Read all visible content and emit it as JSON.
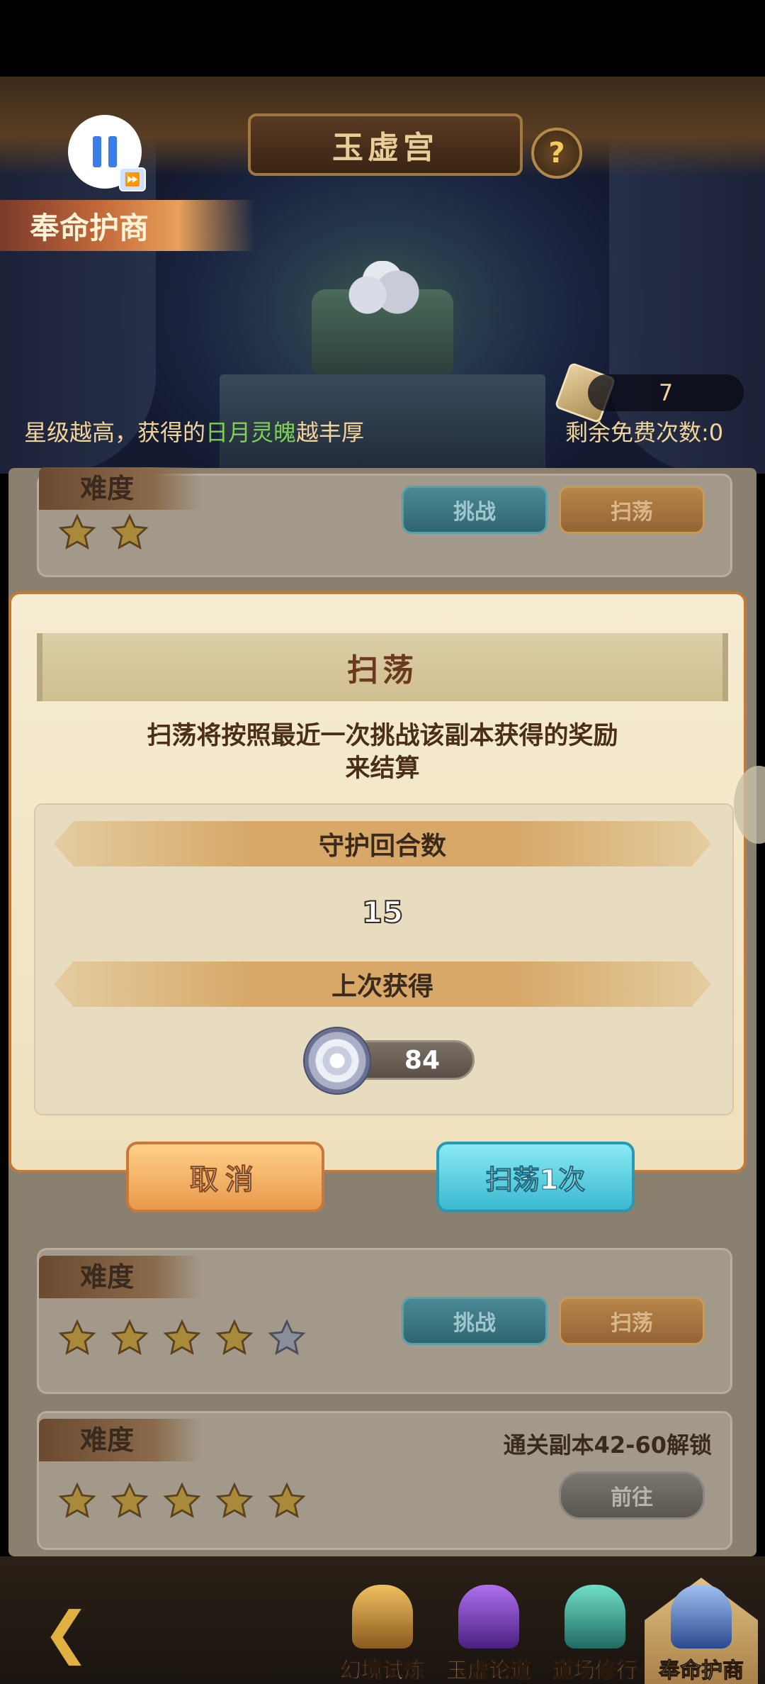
{
  "header": {
    "title": "玉虚宫",
    "help_label": "?",
    "banner": "奉命护商",
    "hint_prefix": "星级越高，获得的",
    "hint_highlight": "日月灵魄",
    "hint_suffix": "越丰厚",
    "ticket_count": "7",
    "free_times": "剩余免费次数:0"
  },
  "overlay": {
    "ff_symbol": "⏩"
  },
  "list": {
    "rows": [
      {
        "difficulty": "难度",
        "stars_filled": 2,
        "challenge": "挑战",
        "sweep": "扫荡"
      },
      {
        "difficulty": "难度",
        "stars_filled": 4,
        "stars_half": 1,
        "challenge": "挑战",
        "sweep": "扫荡"
      },
      {
        "difficulty": "难度",
        "stars_filled": 5,
        "unlock": "通关副本42-60解锁",
        "go": "前往"
      }
    ]
  },
  "dialog": {
    "title": "扫荡",
    "desc_line1": "扫荡将按照最近一次挑战该副本获得的奖励",
    "desc_line2": "来结算",
    "rounds_label": "守护回合数",
    "rounds_value": "15",
    "last_label": "上次获得",
    "reward_value": "84",
    "cancel": "取消",
    "sweep_once": "扫荡1次"
  },
  "nav": {
    "back": "❮",
    "items": [
      {
        "label": "幻境试炼",
        "color": "#d8a040"
      },
      {
        "label": "玉虚论道",
        "color": "#8a4ad0"
      },
      {
        "label": "道场修行",
        "color": "#3ab0a0"
      },
      {
        "label": "奉命护商",
        "color": "#4a78c8"
      }
    ]
  },
  "colors": {
    "star": "#f0c040",
    "highlight": "#7ed050",
    "accent_teal": "#3ab8d0",
    "accent_orange": "#e89a4a"
  }
}
